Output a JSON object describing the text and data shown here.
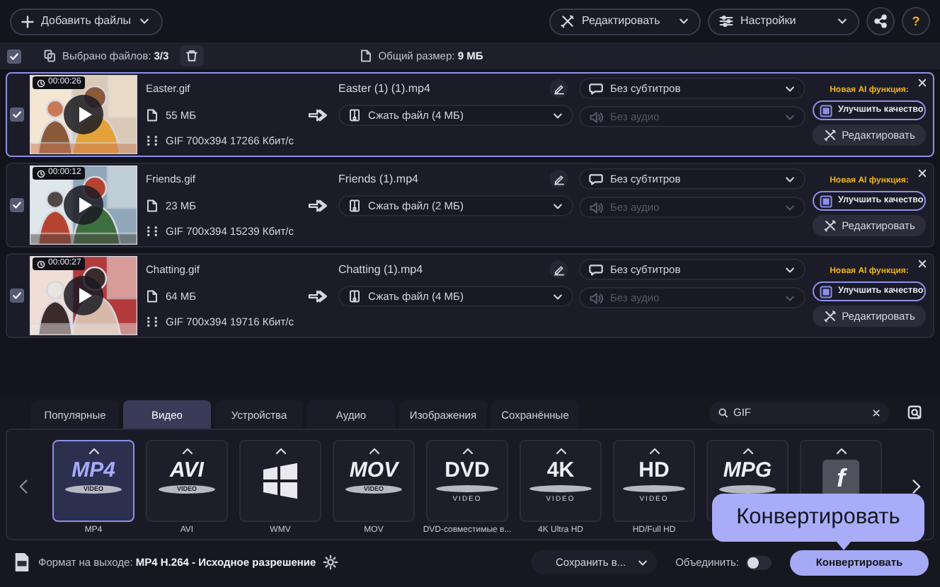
{
  "toolbar": {
    "add_files": "Добавить файлы",
    "edit": "Редактировать",
    "settings": "Настройки",
    "help": "?"
  },
  "selection": {
    "checked": true,
    "label": "Выбрано файлов:",
    "count": "3/3",
    "total_label": "Общий размер:",
    "total": "9 МБ"
  },
  "files": [
    {
      "selected": true,
      "checked": true,
      "duration": "00:00:26",
      "name": "Easter.gif",
      "size": "55 МБ",
      "info": "GIF 700x394 17266 Кбит/с",
      "output_name": "Easter (1) (1).mp4",
      "compress": "Сжать файл (4 МБ)",
      "subtitles": "Без субтитров",
      "audio": "Без аудио",
      "audio_disabled": true,
      "ai_label": "Новая AI функция:",
      "enhance": "Улучшить качество",
      "edit": "Редактировать"
    },
    {
      "selected": false,
      "checked": true,
      "duration": "00:00:12",
      "name": "Friends.gif",
      "size": "23 МБ",
      "info": "GIF 700x394 15239 Кбит/с",
      "output_name": "Friends (1).mp4",
      "compress": "Сжать файл (2 МБ)",
      "subtitles": "Без субтитров",
      "audio": "Без аудио",
      "audio_disabled": true,
      "ai_label": "Новая AI функция:",
      "enhance": "Улучшить качество",
      "edit": "Редактировать"
    },
    {
      "selected": false,
      "checked": true,
      "duration": "00:00:27",
      "name": "Chatting.gif",
      "size": "64 МБ",
      "info": "GIF 700x394 19716 Кбит/с",
      "output_name": "Chatting (1).mp4",
      "compress": "Сжать файл (4 МБ)",
      "subtitles": "Без субтитров",
      "audio": "Без аудио",
      "audio_disabled": true,
      "ai_label": "Новая AI функция:",
      "enhance": "Улучшить качество",
      "edit": "Редактировать"
    }
  ],
  "format_tabs": [
    {
      "label": "Популярные",
      "selected": false
    },
    {
      "label": "Видео",
      "selected": true
    },
    {
      "label": "Устройства",
      "selected": false
    },
    {
      "label": "Аудио",
      "selected": false
    },
    {
      "label": "Изображения",
      "selected": false
    },
    {
      "label": "Сохранённые",
      "selected": false
    }
  ],
  "search": {
    "value": "GIF"
  },
  "formats": [
    {
      "kind": "badge",
      "logo": "MP4",
      "sub": "VIDEO",
      "label": "MP4",
      "selected": true
    },
    {
      "kind": "badge",
      "logo": "AVI",
      "sub": "VIDEO",
      "label": "AVI",
      "selected": false
    },
    {
      "kind": "windows",
      "label": "WMV",
      "selected": false
    },
    {
      "kind": "badge",
      "logo": "MOV",
      "sub": "VIDEO",
      "label": "MOV",
      "selected": false
    },
    {
      "kind": "disc",
      "logo": "DVD",
      "sub": "VIDEO",
      "label": "DVD-совместимые в...",
      "selected": false
    },
    {
      "kind": "disc",
      "logo": "4K",
      "sub": "VIDEO",
      "label": "4K Ultra HD",
      "selected": false
    },
    {
      "kind": "disc",
      "logo": "HD",
      "sub": "VIDEO",
      "label": "HD/Full HD",
      "selected": false
    },
    {
      "kind": "badge",
      "logo": "MPG",
      "selected": false
    },
    {
      "kind": "flash",
      "logo": "f",
      "selected": false
    }
  ],
  "output": {
    "label": "Формат на выходе:",
    "value": "MP4 H.264 - Исходное разрешение",
    "save": "Сохранить в...",
    "merge_label": "Объединить:",
    "merge_on": false,
    "convert": "Конвертировать"
  },
  "tooltip": {
    "text": "Конвертировать"
  }
}
